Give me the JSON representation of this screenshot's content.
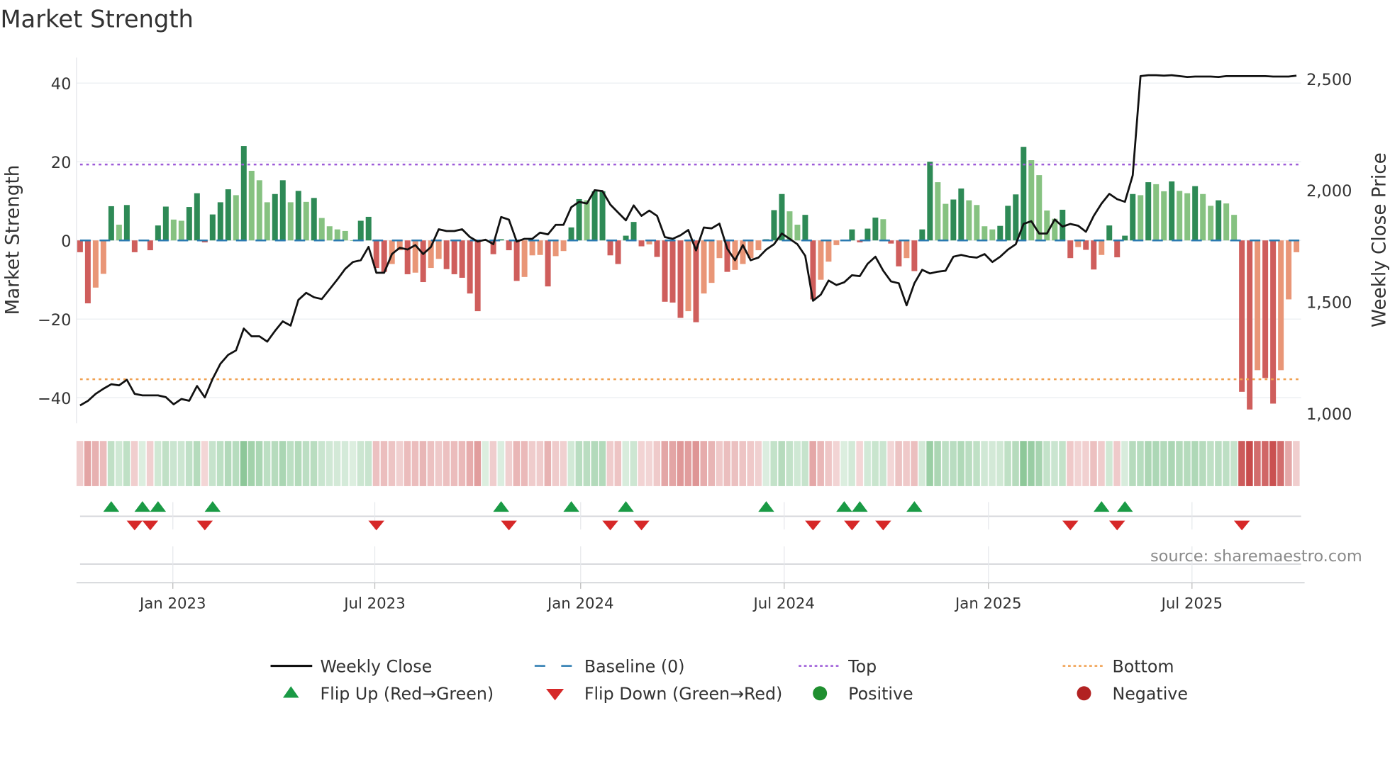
{
  "chart_data": {
    "type": "bar",
    "title": "Market Strength",
    "ylabel": "Market Strength",
    "y2label": "Weekly Close Price",
    "ylim": [
      -46.5,
      46.5
    ],
    "y2lim": [
      955,
      2595
    ],
    "grid": true,
    "source": "source: sharemaestro.com",
    "yticks": [
      {
        "v": 40,
        "label": "40"
      },
      {
        "v": 20,
        "label": "20"
      },
      {
        "v": 0,
        "label": "0"
      },
      {
        "v": -20,
        "label": "−20"
      },
      {
        "v": -40,
        "label": "−40"
      }
    ],
    "y2ticks": [
      {
        "v": 2500,
        "label": "2,500"
      },
      {
        "v": 2000,
        "label": "2,000"
      },
      {
        "v": 1500,
        "label": "1,500"
      },
      {
        "v": 1000,
        "label": "1,000"
      }
    ],
    "xticks": [
      {
        "at": 11.9,
        "label": "Jan 2023"
      },
      {
        "at": 37.8,
        "label": "Jul 2023"
      },
      {
        "at": 64.2,
        "label": "Jan 2024"
      },
      {
        "at": 90.3,
        "label": "Jul 2024"
      },
      {
        "at": 116.5,
        "label": "Jan 2025"
      },
      {
        "at": 142.6,
        "label": "Jul 2025"
      }
    ],
    "top_level": 19.3,
    "bottom_level": -35.3,
    "baseline": 0,
    "strength": [
      -3,
      -16,
      -12,
      -8.5,
      8.7,
      4,
      9,
      -3,
      0,
      -2.5,
      3.8,
      8.6,
      5.3,
      5,
      8.5,
      12,
      -0.5,
      6.6,
      9.7,
      13,
      11.5,
      24,
      17.7,
      15.3,
      9.7,
      11.8,
      15.3,
      9.7,
      12.6,
      9.8,
      10.8,
      5.7,
      3.6,
      2.8,
      2.4,
      0,
      5,
      6,
      -7,
      -8,
      -6,
      -2.5,
      -8.6,
      -8.2,
      -10.6,
      -7,
      -4.7,
      -7.3,
      -8.6,
      -9.5,
      -13.5,
      -18,
      0,
      -3.5,
      0.3,
      -2.5,
      -10.3,
      -9.3,
      -3.8,
      -3.7,
      -11.7,
      -4,
      -2.7,
      3.3,
      10.5,
      10.2,
      12.5,
      12.5,
      -3.8,
      -6,
      1.2,
      4.7,
      -1.5,
      -1,
      -4.2,
      -15.6,
      -15.8,
      -19.7,
      -18,
      -20.8,
      -13.5,
      -10.8,
      -4.5,
      -8,
      -7.5,
      -6,
      -4.5,
      -2.5,
      0.3,
      7.7,
      11.8,
      7.4,
      4,
      6.5,
      -15,
      -10,
      -5.4,
      -1.2,
      0,
      2.8,
      -0.5,
      3,
      5.8,
      5.4,
      -0.8,
      -6.6,
      -4.5,
      -7.8,
      2.8,
      20,
      14.8,
      9.3,
      10.4,
      13.2,
      10.2,
      9,
      3.6,
      2.8,
      3.7,
      8.8,
      11.7,
      23.8,
      20.4,
      16.6,
      7.6,
      5.5,
      7.8,
      -4.5,
      -1.7,
      -2.4,
      -7.4,
      -3.7,
      3.8,
      -4.3,
      1.2,
      11.8,
      11.5,
      14.8,
      14.3,
      12.5,
      15,
      12.6,
      12,
      13.8,
      11.8,
      8.8,
      10.2,
      9.4,
      6.5,
      -38.5,
      -43,
      -33,
      -35,
      -41.5,
      -33,
      -15,
      -3
    ],
    "weekly_close": [
      1035,
      1055,
      1087,
      1110,
      1130,
      1125,
      1150,
      1087,
      1080,
      1080,
      1080,
      1072,
      1040,
      1064,
      1056,
      1122,
      1071,
      1154,
      1222,
      1262,
      1282,
      1380,
      1345,
      1345,
      1321,
      1369,
      1412,
      1393,
      1508,
      1540,
      1520,
      1512,
      1556,
      1600,
      1647,
      1678,
      1686,
      1746,
      1630,
      1630,
      1714,
      1742,
      1734,
      1754,
      1714,
      1746,
      1825,
      1817,
      1817,
      1825,
      1790,
      1770,
      1778,
      1758,
      1880,
      1868,
      1770,
      1782,
      1782,
      1810,
      1802,
      1845,
      1845,
      1924,
      1948,
      1940,
      2000,
      1996,
      1936,
      1900,
      1865,
      1932,
      1885,
      1909,
      1885,
      1790,
      1782,
      1798,
      1822,
      1730,
      1833,
      1829,
      1850,
      1738,
      1686,
      1754,
      1686,
      1698,
      1734,
      1758,
      1806,
      1782,
      1758,
      1706,
      1504,
      1532,
      1595,
      1575,
      1587,
      1619,
      1615,
      1670,
      1702,
      1639,
      1591,
      1583,
      1484,
      1583,
      1643,
      1627,
      1635,
      1639,
      1702,
      1710,
      1702,
      1698,
      1714,
      1678,
      1702,
      1734,
      1758,
      1849,
      1861,
      1806,
      1806,
      1869,
      1837,
      1849,
      1841,
      1814,
      1885,
      1940,
      1984,
      1960,
      1948,
      2067,
      2512,
      2516,
      2516,
      2514,
      2516,
      2512,
      2508,
      2510,
      2510,
      2510,
      2508,
      2512,
      2512,
      2512,
      2512,
      2512,
      2512,
      2510,
      2510,
      2510,
      2514
    ],
    "flip_up": [
      4,
      8,
      10,
      17,
      54,
      63,
      70,
      88,
      98,
      100,
      107,
      131,
      134
    ],
    "flip_down": [
      7,
      9,
      16,
      38,
      55,
      68,
      72,
      94,
      99,
      103,
      127,
      133,
      149
    ],
    "legend": [
      {
        "label": "Weekly Close",
        "kind": "line",
        "color": "#111111"
      },
      {
        "label": "Baseline (0)",
        "kind": "dash",
        "color": "#2a7ab0"
      },
      {
        "label": "Top",
        "kind": "dot",
        "color": "#9d5bd8"
      },
      {
        "label": "Bottom",
        "kind": "dot",
        "color": "#f0a050"
      },
      {
        "label": "Flip Up (Red→Green)",
        "kind": "up",
        "color": "#1a9a45"
      },
      {
        "label": "Flip Down (Green→Red)",
        "kind": "down",
        "color": "#d62828"
      },
      {
        "label": "Positive",
        "kind": "circle",
        "color": "#1f8f2f"
      },
      {
        "label": "Negative",
        "kind": "circle",
        "color": "#b22222"
      }
    ],
    "colors": {
      "pos_strong": "#2e8a56",
      "pos_weak": "#86c281",
      "neg_strong": "#cf5e5c",
      "neg_weak": "#e99677"
    }
  }
}
